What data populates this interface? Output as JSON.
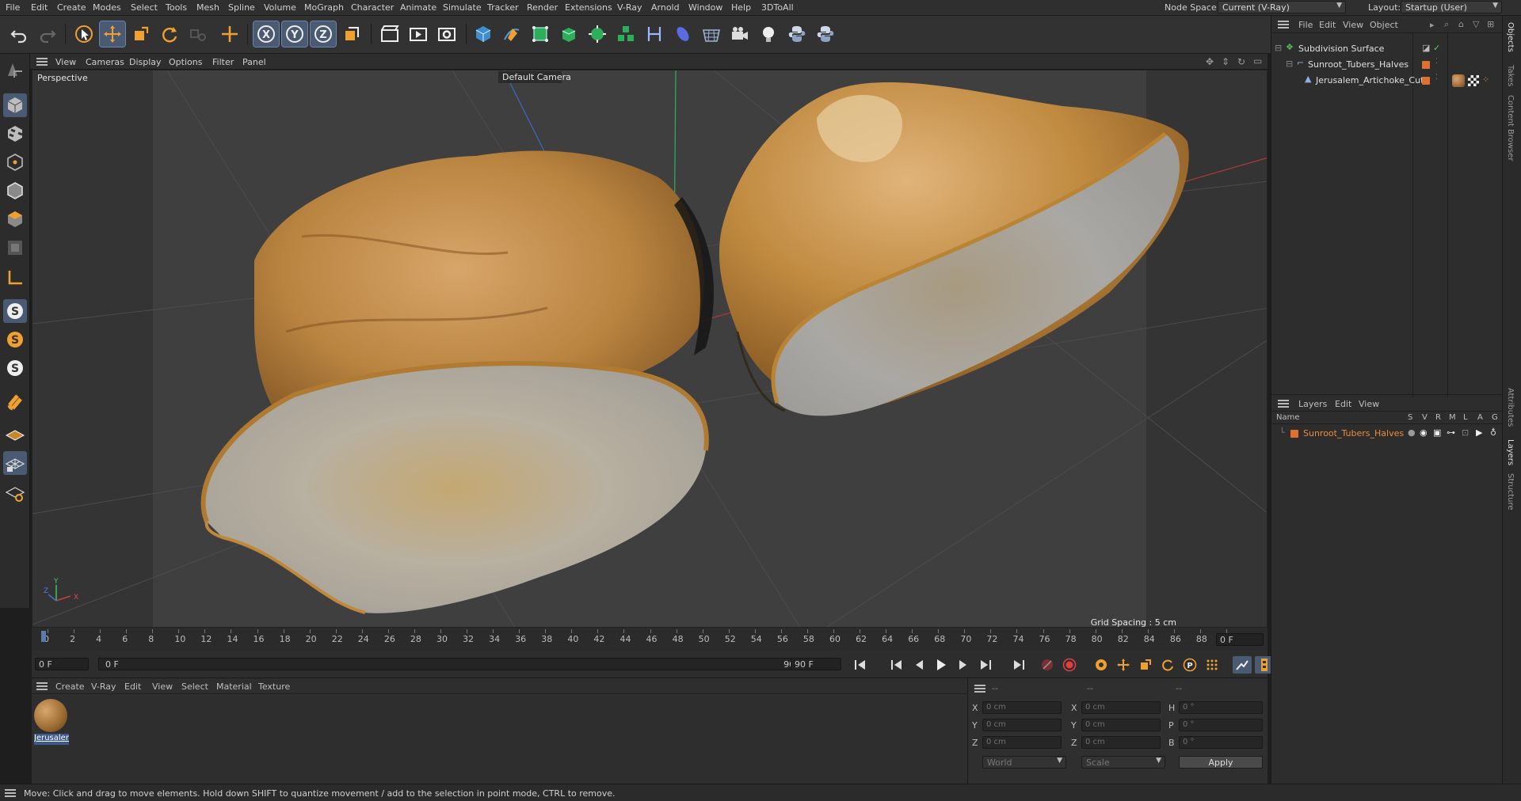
{
  "menubar": {
    "items": [
      "File",
      "Edit",
      "Create",
      "Modes",
      "Select",
      "Tools",
      "Mesh",
      "Spline",
      "Volume",
      "MoGraph",
      "Character",
      "Animate",
      "Simulate",
      "Tracker",
      "Render",
      "Extensions",
      "V-Ray",
      "Arnold",
      "Window",
      "Help",
      "3DToAll"
    ],
    "node_space_label": "Node Space:",
    "node_space_value": "Current (V-Ray)",
    "layout_label": "Layout:",
    "layout_value": "Startup (User)"
  },
  "viewport": {
    "menu": [
      "View",
      "Cameras",
      "Display",
      "Options",
      "Filter",
      "Panel"
    ],
    "view_name": "Perspective",
    "camera_label": "Default Camera",
    "grid_spacing": "Grid Spacing : 5 cm",
    "axis_x": "X",
    "axis_y": "Y",
    "axis_z": "Z"
  },
  "timeline": {
    "ticks": [
      "0",
      "2",
      "4",
      "6",
      "8",
      "10",
      "12",
      "14",
      "16",
      "18",
      "20",
      "22",
      "24",
      "26",
      "28",
      "30",
      "32",
      "34",
      "36",
      "38",
      "40",
      "42",
      "44",
      "46",
      "48",
      "50",
      "52",
      "54",
      "56",
      "58",
      "60",
      "62",
      "64",
      "66",
      "68",
      "70",
      "72",
      "74",
      "76",
      "78",
      "80",
      "82",
      "84",
      "86",
      "88",
      "90"
    ],
    "current_frame": "0 F",
    "start_frame": "0 F",
    "range_start": "0 F",
    "range_end": "90 F",
    "end_frame": "90 F"
  },
  "material_panel": {
    "menu": [
      "Create",
      "V-Ray",
      "Edit",
      "View",
      "Select",
      "Material",
      "Texture"
    ],
    "material_name": "Jerusaler"
  },
  "coord_panel": {
    "col1_header": "--",
    "col2_header": "--",
    "col3_header": "--",
    "rows": [
      {
        "a": "X",
        "av": "0 cm",
        "b": "X",
        "bv": "0 cm",
        "c": "H",
        "cv": "0 °"
      },
      {
        "a": "Y",
        "av": "0 cm",
        "b": "Y",
        "bv": "0 cm",
        "c": "P",
        "cv": "0 °"
      },
      {
        "a": "Z",
        "av": "0 cm",
        "b": "Z",
        "bv": "0 cm",
        "c": "B",
        "cv": "0 °"
      }
    ],
    "space": "World",
    "mode": "Scale",
    "apply": "Apply"
  },
  "objects_panel": {
    "menu": [
      "File",
      "Edit",
      "View",
      "Object"
    ],
    "items": [
      "Subdivision Surface",
      "Sunroot_Tubers_Halves",
      "Jerusalem_Artichoke_Cut"
    ]
  },
  "layers_panel": {
    "menu": [
      "Layers",
      "Edit",
      "View"
    ],
    "name_header": "Name",
    "flags": [
      "S",
      "V",
      "R",
      "M",
      "L",
      "A",
      "G"
    ],
    "layer_name": "Sunroot_Tubers_Halves",
    "layer_color": "#e07030"
  },
  "right_tabs": {
    "top": [
      "Objects",
      "Takes",
      "Content Browser"
    ],
    "bottom": [
      "Attributes",
      "Layers",
      "Structure"
    ]
  },
  "status": "Move: Click and drag to move elements. Hold down SHIFT to quantize movement / add to the selection in point mode, CTRL to remove.",
  "colors": {
    "accent": "#e07030",
    "selection": "#4a5a72",
    "axis_x": "#c84040",
    "axis_y": "#40c060",
    "axis_z": "#4070d0"
  }
}
